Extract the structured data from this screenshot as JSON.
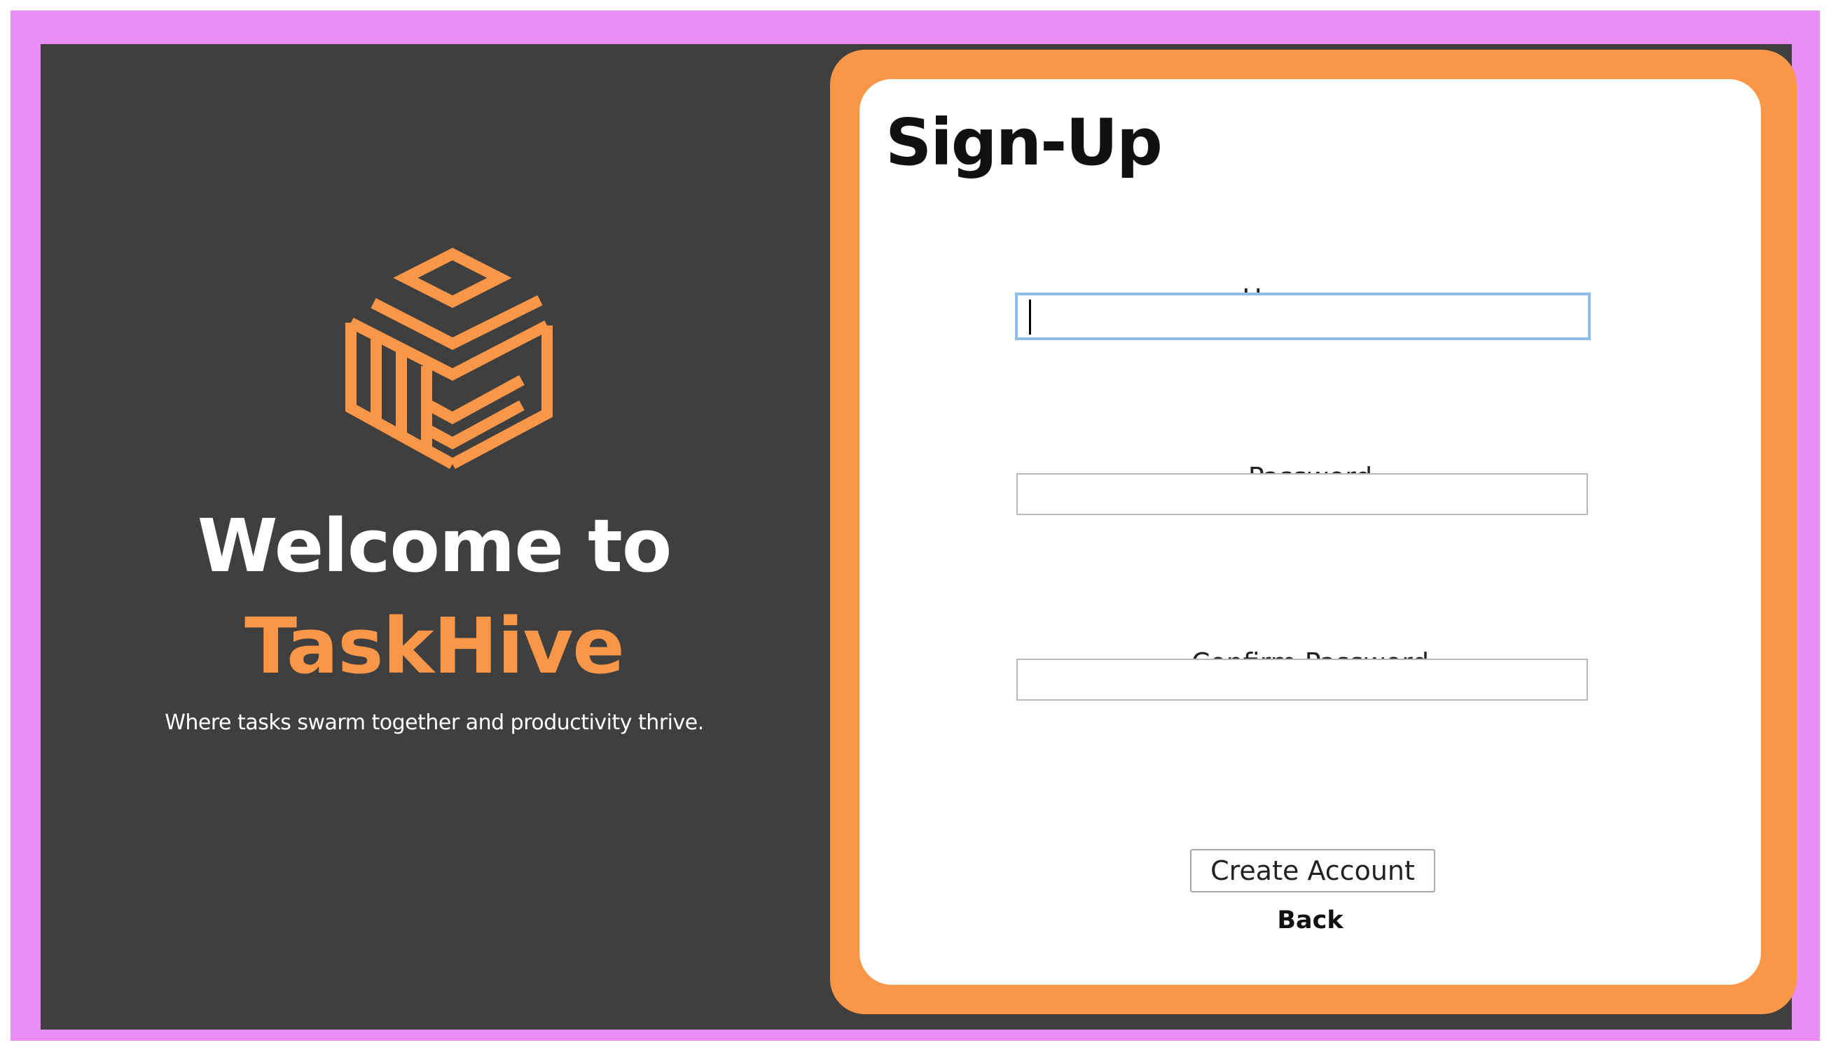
{
  "branding": {
    "welcome": "Welcome to",
    "brand_name": "TaskHive",
    "tagline": "Where tasks swarm together and productivity thrive."
  },
  "signup": {
    "title": "Sign-Up",
    "username_label": "Username",
    "username_value": "",
    "password_label": "Password",
    "password_value": "",
    "confirm_label": "Confirm Password",
    "confirm_value": "",
    "create_button": "Create Account",
    "back_button": "Back"
  },
  "colors": {
    "frame": "#ea8df7",
    "background": "#3f3f3f",
    "accent": "#f99647",
    "card": "#ffffff",
    "focus_border": "#8fbbe8"
  },
  "icons": {
    "logo": "hexagon-cube-logo-icon"
  }
}
